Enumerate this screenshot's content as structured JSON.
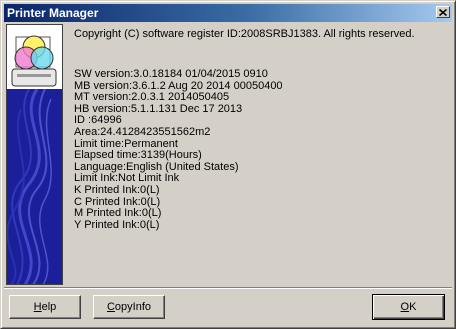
{
  "window": {
    "title": "Printer Manager",
    "close_glyph": "×"
  },
  "info": {
    "copyright": "Copyright (C) software register ID:2008SRBJ1383. All rights reserved.",
    "lines": [
      "SW version:3.0.18184  01/04/2015 0910",
      "MB version:3.6.1.2 Aug 20 2014 00050400",
      "MT version:2.0.3.1 2014050405",
      "HB version:5.1.1.131 Dec 17 2013",
      "ID :64996",
      "Area:24.4128423551562m2",
      "Limit time:Permanent",
      "Elapsed time:3139(Hours)",
      "Language:English (United States)",
      "Limit Ink:Not Limit Ink",
      "K Printed Ink:0(L)",
      "C Printed Ink:0(L)",
      "M Printed Ink:0(L)",
      "Y Printed Ink:0(L)"
    ]
  },
  "buttons": {
    "help": {
      "mnemonic": "H",
      "rest": "elp"
    },
    "copyinfo": {
      "mnemonic": "C",
      "rest": "opyInfo"
    },
    "ok": {
      "mnemonic": "O",
      "rest": "K"
    }
  },
  "icons": {
    "close": "close-icon",
    "logo": "ink-circles-logo"
  },
  "colors": {
    "titlebar_start": "#0a246a",
    "titlebar_end": "#a6caf0",
    "dialog_face": "#d4d0c8",
    "side_panel": "#1c1f9a"
  }
}
